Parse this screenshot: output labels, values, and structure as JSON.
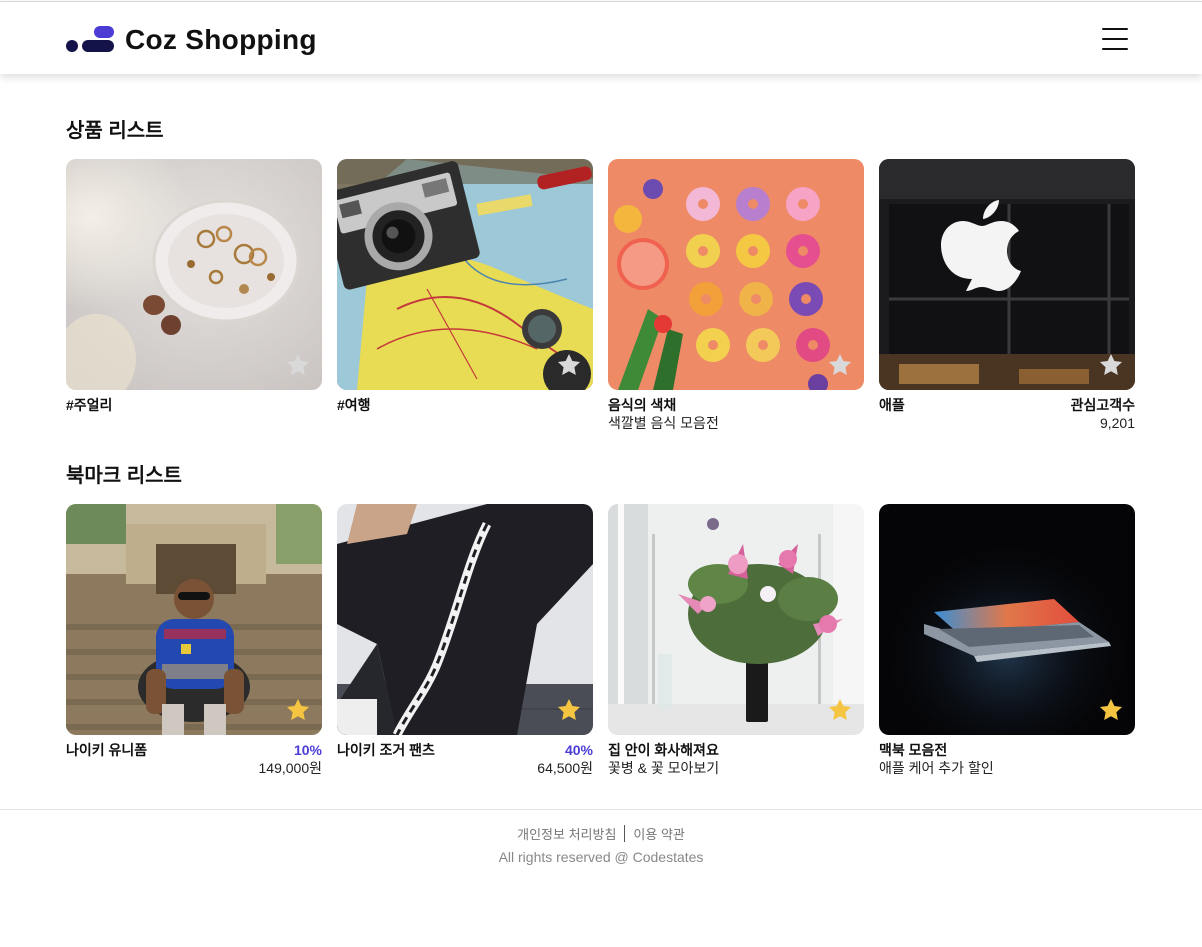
{
  "header": {
    "logo_text": "Coz Shopping",
    "brand_colors": {
      "dark": "#13134a",
      "accent": "#4b3cd6"
    },
    "menu_icon": "hamburger-menu-icon"
  },
  "product_section": {
    "title": "상품 리스트",
    "items": [
      {
        "type": "category",
        "title": "#주얼리",
        "image": "jewelry-dish-photo",
        "bookmarked": false
      },
      {
        "type": "category",
        "title": "#여행",
        "image": "camera-map-photo",
        "bookmarked": false
      },
      {
        "type": "exhibition",
        "title": "음식의 색채",
        "subtitle": "색깔별 음식 모음전",
        "image": "colorful-donuts-photo",
        "bookmarked": false
      },
      {
        "type": "brand",
        "title": "애플",
        "right_label": "관심고객수",
        "right_value": "9,201",
        "image": "apple-store-photo",
        "bookmarked": false
      }
    ]
  },
  "bookmark_section": {
    "title": "북마크 리스트",
    "items": [
      {
        "type": "product",
        "title": "나이키 유니폼",
        "discount": "10%",
        "price": "149,000원",
        "image": "man-in-jersey-photo",
        "bookmarked": true
      },
      {
        "type": "product",
        "title": "나이키 조거 팬츠",
        "discount": "40%",
        "price": "64,500원",
        "image": "jogger-pants-photo",
        "bookmarked": true
      },
      {
        "type": "exhibition",
        "title": "집 안이 화사해져요",
        "subtitle": "꽃병 & 꽃 모아보기",
        "image": "flower-vase-photo",
        "bookmarked": true
      },
      {
        "type": "exhibition",
        "title": "맥북 모음전",
        "subtitle": "애플 케어 추가 할인",
        "image": "macbook-dark-photo",
        "bookmarked": true
      }
    ]
  },
  "footer": {
    "privacy": "개인정보 처리방침",
    "terms": "이용 약관",
    "copyright": "All rights reserved @ Codestates"
  },
  "colors": {
    "star_active": "#f5c542",
    "star_inactive": "#d9d9d9"
  }
}
